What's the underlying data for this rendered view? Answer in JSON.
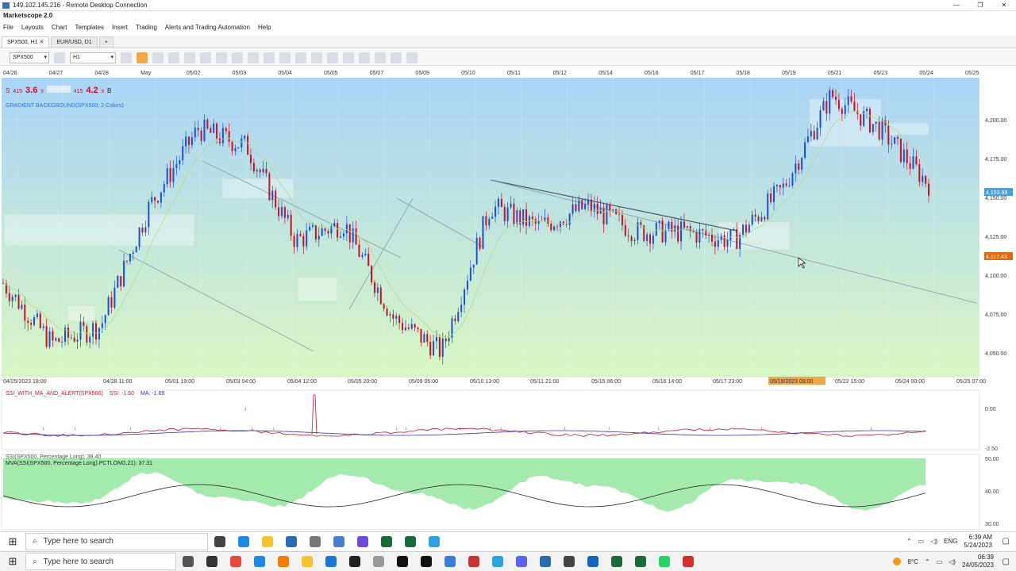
{
  "window": {
    "title": "149.102.145.216 - Remote Desktop Connection",
    "app_title": "Marketscope 2.0"
  },
  "menu": [
    "File",
    "Layouts",
    "Chart",
    "Templates",
    "Insert",
    "Trading",
    "Alerts and Trading Automation",
    "Help"
  ],
  "tabs": [
    {
      "label": "SPX500, H1",
      "active": true
    },
    {
      "label": "EUR/USD, D1",
      "active": false
    },
    {
      "label": "+",
      "active": false
    }
  ],
  "toolbar": {
    "instrument": "SPX500",
    "timeframe": "H1"
  },
  "top_dates": [
    "04/26",
    "04/27",
    "04/28",
    "May",
    "05/02",
    "05/03",
    "05/04",
    "05/05",
    "05/07",
    "05/09",
    "05/10",
    "05/11",
    "05/12",
    "05/14",
    "05/16",
    "05/17",
    "05/18",
    "05/19",
    "05/21",
    "05/23",
    "05/24",
    "05/25"
  ],
  "quote": {
    "sell_label": "S",
    "sell_big": "415",
    "sell_pips": "3.6",
    "sell_sup": "9",
    "buy_big": "415",
    "buy_pips": "4.2",
    "buy_sup": "9",
    "buy_label": "B"
  },
  "indicator_label": "GRADIENT BACKGROUND(SPX500, 2-Colors)",
  "price_axis": [
    "4,200.00",
    "4,175.00",
    "4,150.00",
    "4,125.00",
    "4,100.00",
    "4,075.00",
    "4,050.00"
  ],
  "price_tags": {
    "current": "4,153.69",
    "line": "4,117.43"
  },
  "bottom_dates": [
    "04/25/2023 18:00",
    "04/28 11:00",
    "05/01 19:00",
    "05/03 04:00",
    "05/04 12:00",
    "05/05 20:00",
    "05/09 05:00",
    "05/10 13:00",
    "05/11 21:00",
    "05/15 06:00",
    "05/16 14:00",
    "05/17 23:00",
    "05/19/2023 09:00",
    "05/22 15:00",
    "05/24 00:00",
    "05/25 07:00"
  ],
  "ssi_panel": {
    "title": "SSI_WITH_MA_AND_ALERT(SPX500)",
    "ssi": "SSI: -1.60",
    "ma": "MA: -1.69",
    "axis": [
      "0.00",
      "-2.50"
    ]
  },
  "mva_panel": {
    "title1": "SSI(SPX500, Percentage Long): 38.40",
    "title2": "MVA(SSI(SPX500, Percentage Long).PCTLONG,21): 37.31",
    "axis": [
      "50.00",
      "40.00",
      "30.00"
    ]
  },
  "taskbar": {
    "search_placeholder": "Type here to search",
    "search_placeholder2": "Type here to search",
    "lang": "ENG",
    "time1": "6:39 AM",
    "date1": "5/24/2023",
    "temp": "8°C",
    "time2": "06:39",
    "date2": "24/05/2023"
  },
  "colors": {
    "bull": "#1a4fd6",
    "bear": "#cc1020",
    "bg_top": "#a9d4f7",
    "bg_bottom": "#d6f5c2",
    "accent": "#f1a64a",
    "green_fill": "#9be8a4"
  },
  "chart_data": {
    "type": "candlestick",
    "instrument": "SPX500",
    "timeframe": "H1",
    "ylim": [
      4040,
      4215
    ],
    "close_path": [
      {
        "x": "04/25/2023 18:00",
        "y": 4095
      },
      {
        "x": "04/26",
        "y": 4060
      },
      {
        "x": "04/27",
        "y": 4070
      },
      {
        "x": "04/28 11:00",
        "y": 4140
      },
      {
        "x": "May",
        "y": 4185
      },
      {
        "x": "05/01 19:00",
        "y": 4175
      },
      {
        "x": "05/02",
        "y": 4120
      },
      {
        "x": "05/03 04:00",
        "y": 4130
      },
      {
        "x": "05/03",
        "y": 4075
      },
      {
        "x": "05/04 12:00",
        "y": 4055
      },
      {
        "x": "05/05 20:00",
        "y": 4140
      },
      {
        "x": "05/09 05:00",
        "y": 4128
      },
      {
        "x": "05/10 13:00",
        "y": 4140
      },
      {
        "x": "05/11 21:00",
        "y": 4125
      },
      {
        "x": "05/15 06:00",
        "y": 4125
      },
      {
        "x": "05/16 14:00",
        "y": 4120
      },
      {
        "x": "05/17 23:00",
        "y": 4150
      },
      {
        "x": "05/19/2023 09:00",
        "y": 4205
      },
      {
        "x": "05/22 15:00",
        "y": 4185
      },
      {
        "x": "05/24 00:00",
        "y": 4153
      }
    ]
  }
}
